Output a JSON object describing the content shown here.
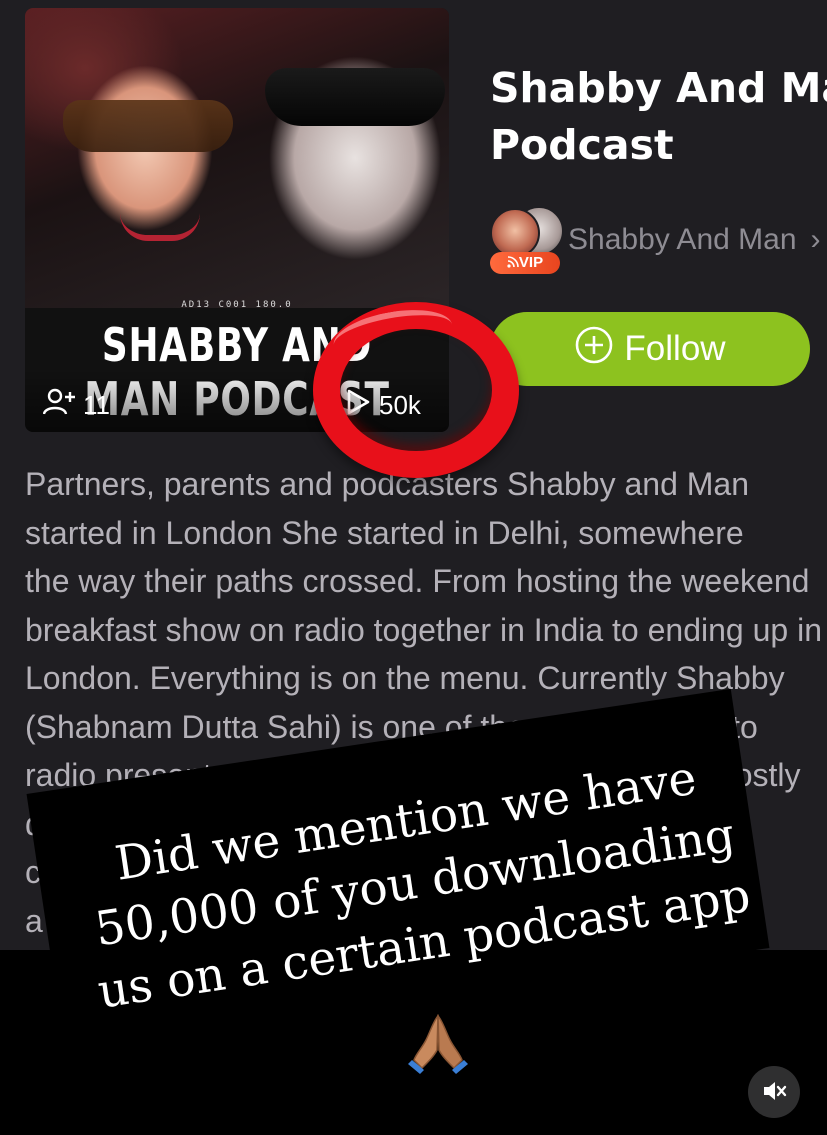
{
  "podcast": {
    "title": "Shabby And Man\nPodcast",
    "author": "Shabby And Man",
    "author_badge": "VIP",
    "follow_label": "Follow",
    "description": "Partners, parents and podcasters Shabby and Man\nstarted in London She started in Delhi, somewhere\nthe way their paths crossed. From hosting the weekend\nbreakfast show on radio together in India to ending up in\nLondon. Everything is on the menu. Currently Shabby\n(Shabnam Dutta Sahi) is one of the most listened to\nradio presenters in the UK, while Man has been mostly\ndrinking copious amounts of wine and\ncontemplating the meaning of\na"
  },
  "cover": {
    "title": "SHABBY AND\nMAN PODCAST",
    "strip_text": "AD13  C001    180.0",
    "subscribers": "11",
    "plays": "50k"
  },
  "story": {
    "caption": "Did we mention we have\n50,000 of you downloading\nus on a certain podcast app",
    "emoji": "folded-hands",
    "annotation_color": "#e8101a"
  },
  "colors": {
    "follow_green": "#8dc21f",
    "background": "#1f1e22",
    "muted_text": "#8e8c93"
  },
  "icons": {
    "subscribers": "user-plus-icon",
    "plays": "play-icon",
    "follow": "plus-circle-icon",
    "author_chevron": "chevron-right-icon",
    "mute": "speaker-muted-icon"
  }
}
